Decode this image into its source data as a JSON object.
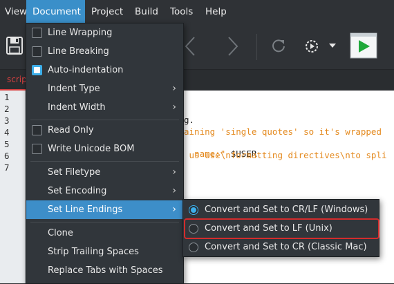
{
  "menubar": {
    "items": [
      {
        "label": "View"
      },
      {
        "label": "Document"
      },
      {
        "label": "Project"
      },
      {
        "label": "Build"
      },
      {
        "label": "Tools"
      },
      {
        "label": "Help"
      }
    ]
  },
  "toolbar": {
    "icons": [
      "save-icon",
      "back-icon",
      "forward-icon",
      "reload-icon",
      "run-config-icon",
      "dropdown-icon",
      "run-icon"
    ]
  },
  "tabs": [
    {
      "label": "script"
    }
  ],
  "editor": {
    "line_numbers": [
      "1",
      "2",
      "3",
      "4",
      "5",
      "6",
      "7"
    ],
    "lines": [
      {
        "plain": "",
        "str": ""
      },
      {
        "plain": "",
        "str": ""
      },
      {
        "plain": "g.",
        "str": ""
      },
      {
        "plain": "",
        "str": "aining 'single quotes' so it's wrapped"
      },
      {
        "plain": " $USER",
        "str": "name:\""
      },
      {
        "plain": "",
        "str": " us use\\nformatting directives\\nto spli"
      },
      {
        "plain": "",
        "str": ""
      }
    ]
  },
  "document_menu": {
    "groups": [
      [
        {
          "label": "Line Wrapping",
          "type": "check",
          "checked": false
        },
        {
          "label": "Line Breaking",
          "type": "check",
          "checked": false
        },
        {
          "label": "Auto-indentation",
          "type": "check",
          "checked": true
        },
        {
          "label": "Indent Type",
          "type": "submenu"
        },
        {
          "label": "Indent Width",
          "type": "submenu"
        }
      ],
      [
        {
          "label": "Read Only",
          "type": "check",
          "checked": false
        },
        {
          "label": "Write Unicode BOM",
          "type": "check",
          "checked": false
        }
      ],
      [
        {
          "label": "Set Filetype",
          "type": "submenu"
        },
        {
          "label": "Set Encoding",
          "type": "submenu"
        },
        {
          "label": "Set Line Endings",
          "type": "submenu",
          "highlighted": true
        }
      ],
      [
        {
          "label": "Clone",
          "type": "item"
        },
        {
          "label": "Strip Trailing Spaces",
          "type": "item"
        },
        {
          "label": "Replace Tabs with Spaces",
          "type": "item"
        }
      ]
    ]
  },
  "line_endings_menu": {
    "items": [
      {
        "label": "Convert and Set to CR/LF (Windows)",
        "selected": true
      },
      {
        "label": "Convert and Set to LF (Unix)",
        "selected": false,
        "outlined": true
      },
      {
        "label": "Convert and Set to CR (Classic Mac)",
        "selected": false
      }
    ]
  },
  "colors": {
    "accent": "#3daee9",
    "highlight": "#3d8ec9",
    "outline": "#d42c2c",
    "string": "#e48a1f"
  }
}
